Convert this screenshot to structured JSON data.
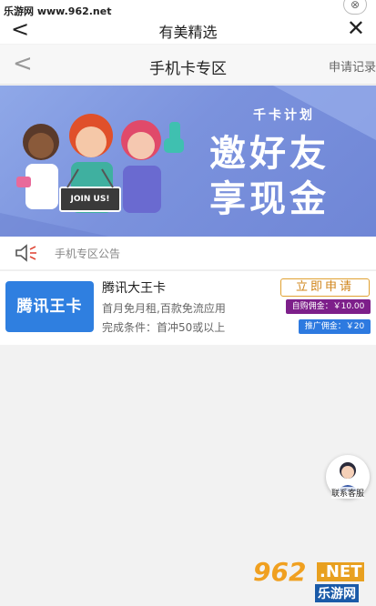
{
  "watermark": {
    "site": "乐游网 www.962.net",
    "logo_num": "962",
    "logo_net": ".NET",
    "logo_cn": "乐游网"
  },
  "topbar": {
    "back": "<",
    "title": "有美精选",
    "close": "✕"
  },
  "subbar": {
    "back": "<",
    "title": "手机卡专区",
    "apply_record": "申请记录"
  },
  "banner": {
    "tagline": "千卡计划",
    "headline1": "邀好友",
    "headline2": "享现金",
    "sign": "JOIN US!"
  },
  "notice": {
    "text": "手机专区公告"
  },
  "card": {
    "logo_text": "腾讯王卡",
    "name": "腾讯大王卡",
    "desc": "首月免月租,百款免流应用",
    "condition": "完成条件：首冲50或以上",
    "apply_button": "立即申请",
    "self_commission": "自购佣金：￥10.00",
    "promo_commission": "推广佣金：￥20"
  },
  "service": {
    "label": "联系客服"
  }
}
